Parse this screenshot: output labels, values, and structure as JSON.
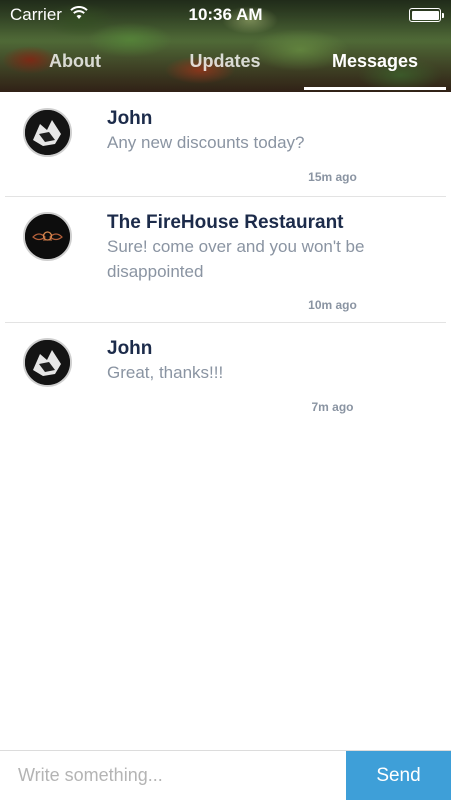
{
  "status_bar": {
    "carrier": "Carrier",
    "time": "10:36 AM"
  },
  "tabs": [
    {
      "label": "About",
      "active": false
    },
    {
      "label": "Updates",
      "active": false
    },
    {
      "label": "Messages",
      "active": true
    }
  ],
  "messages": [
    {
      "sender": "John",
      "text": "Any new discounts today?",
      "time": "15m ago"
    },
    {
      "sender": "The FireHouse Restaurant",
      "text": "Sure! come over and you won't be disappointed",
      "time": "10m ago"
    },
    {
      "sender": "John",
      "text": "Great, thanks!!!",
      "time": "7m ago"
    }
  ],
  "compose": {
    "placeholder": "Write something...",
    "send_label": "Send"
  },
  "colors": {
    "accent": "#3e9fd8",
    "name": "#1c2b4a",
    "muted": "#8a94a2"
  }
}
